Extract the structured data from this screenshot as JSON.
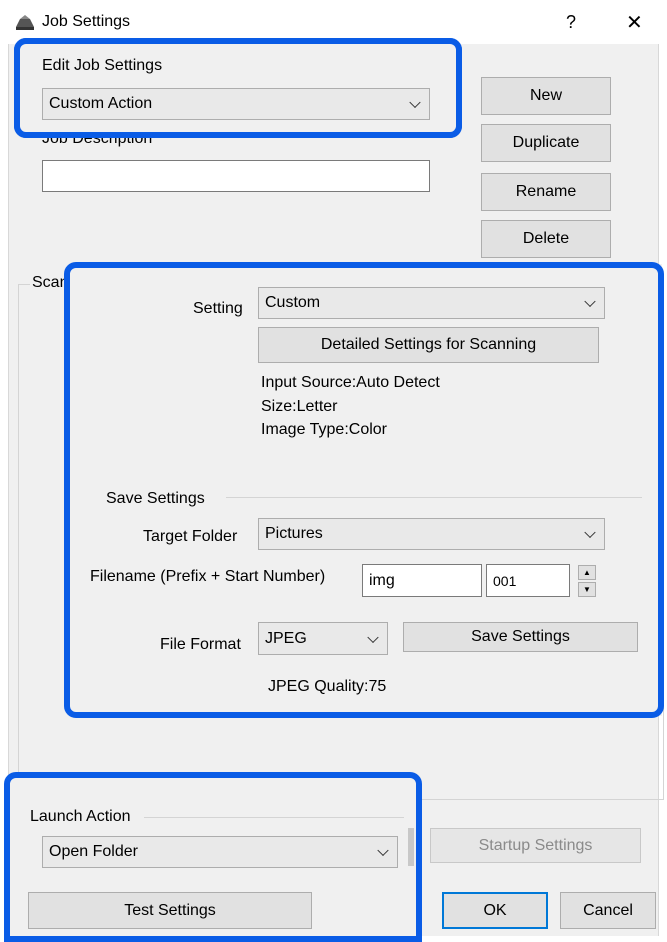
{
  "window": {
    "title": "Job Settings",
    "help_glyph": "?",
    "close_glyph": "✕"
  },
  "edit_job": {
    "label": "Edit Job Settings",
    "value": "Custom Action"
  },
  "job_description": {
    "label": "Job Description",
    "value": ""
  },
  "side_buttons": {
    "new": "New",
    "duplicate": "Duplicate",
    "rename": "Rename",
    "delete": "Delete"
  },
  "scan_settings": {
    "group_label": "Scan Settings",
    "setting_label": "Setting",
    "setting_value": "Custom",
    "detailed_button": "Detailed Settings for Scanning",
    "info": {
      "input_source": "Input Source:Auto Detect",
      "size": "Size:Letter",
      "image_type": "Image Type:Color"
    }
  },
  "save_settings": {
    "group_label": "Save Settings",
    "target_folder_label": "Target Folder",
    "target_folder_value": "Pictures",
    "filename_label": "Filename (Prefix + Start Number)",
    "prefix_value": "img",
    "start_number_value": "001",
    "file_format_label": "File Format",
    "file_format_value": "JPEG",
    "save_settings_button": "Save Settings",
    "jpeg_quality": "JPEG Quality:75"
  },
  "launch_action": {
    "label": "Launch Action",
    "value": "Open Folder",
    "startup_settings_button": "Startup Settings"
  },
  "footer": {
    "test_settings": "Test Settings",
    "ok": "OK",
    "cancel": "Cancel"
  }
}
